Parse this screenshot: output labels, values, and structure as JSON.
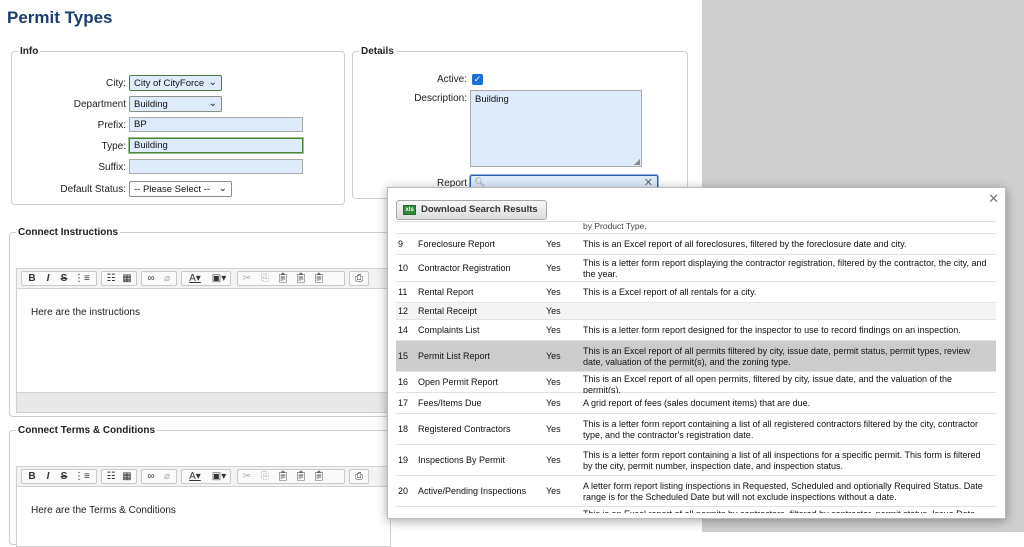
{
  "page_title": "Permit Types",
  "info": {
    "legend": "Info",
    "city_label": "City:",
    "city_value": "City of CityForce",
    "department_label": "Department",
    "department_value": "Building",
    "prefix_label": "Prefix:",
    "prefix_value": "BP",
    "type_label": "Type:",
    "type_value": "Building",
    "suffix_label": "Suffix:",
    "suffix_value": "",
    "default_status_label": "Default Status:",
    "default_status_value": "-- Please Select --"
  },
  "details": {
    "legend": "Details",
    "active_label": "Active:",
    "active_checked": true,
    "description_label": "Description:",
    "description_value": "Building",
    "report_label": "Report",
    "report_value": ""
  },
  "connect_instructions": {
    "legend": "Connect Instructions",
    "content": "Here are the instructions"
  },
  "connect_terms": {
    "legend": "Connect Terms & Conditions",
    "content": "Here are the Terms & Conditions"
  },
  "toolbar_icons": [
    "bold-icon",
    "italic-icon",
    "strikethrough-icon",
    "ordered-list-icon",
    "unordered-list-icon",
    "table-icon",
    "link-icon",
    "unlink-icon",
    "text-color-icon",
    "background-color-icon",
    "cut-icon",
    "copy-icon",
    "paste-icon",
    "paste-text-icon",
    "paste-word-icon",
    "print-icon"
  ],
  "popup": {
    "download_label": "Download Search Results",
    "top_fragment": "by Product Type.",
    "rows": [
      {
        "id": "9",
        "name": "Foreclosure Report",
        "active": "Yes",
        "desc": "This is an Excel report of all foreclosures, filtered by the foreclosure date and city."
      },
      {
        "id": "10",
        "name": "Contractor Registration",
        "active": "Yes",
        "desc": "This is a letter form report displaying the contractor registration, filtered by the contractor, the city, and the year."
      },
      {
        "id": "11",
        "name": "Rental Report",
        "active": "Yes",
        "desc": "This is a Excel report of all rentals for a city."
      },
      {
        "id": "12",
        "name": "Rental Receipt",
        "active": "Yes",
        "desc": ""
      },
      {
        "id": "14",
        "name": "Complaints List",
        "active": "Yes",
        "desc": "This is a letter form report designed for the inspector to use to record findings on an inspection."
      },
      {
        "id": "15",
        "name": "Permit List Report",
        "active": "Yes",
        "desc": "This is an Excel report of all permits filtered by city, issue date, permit status, permit types, review date, valuation of the permit(s), and the zoning type."
      },
      {
        "id": "16",
        "name": "Open Permit Report",
        "active": "Yes",
        "desc": "This is an Excel report of all open permits, filtered by city, issue date, and the valuation of the permit(s)."
      },
      {
        "id": "17",
        "name": "Fees/Items Due",
        "active": "Yes",
        "desc": "A grid report of fees (sales document items) that are due."
      },
      {
        "id": "18",
        "name": "Registered Contractors",
        "active": "Yes",
        "desc": "This is a letter form report containing a list of all registered contractors filtered by the city, contractor type, and the contractor's registration date."
      },
      {
        "id": "19",
        "name": "Inspections By Permit",
        "active": "Yes",
        "desc": "This is a letter form report containing a list of all inspections for a specific permit. This form is filtered by the city, permit number, inspection date, and inspection status."
      },
      {
        "id": "20",
        "name": "Active/Pending Inspections",
        "active": "Yes",
        "desc": "A letter form report listing inspections in Requested, Scheduled and optionally Required Status. Date range is for the Scheduled Date but will not exclude inspections without a date."
      },
      {
        "id": "",
        "name": "",
        "active": "",
        "desc": "This is an Excel report of all permits by contractors, filtered by contractor, permit status, Issue Date, and"
      }
    ]
  }
}
